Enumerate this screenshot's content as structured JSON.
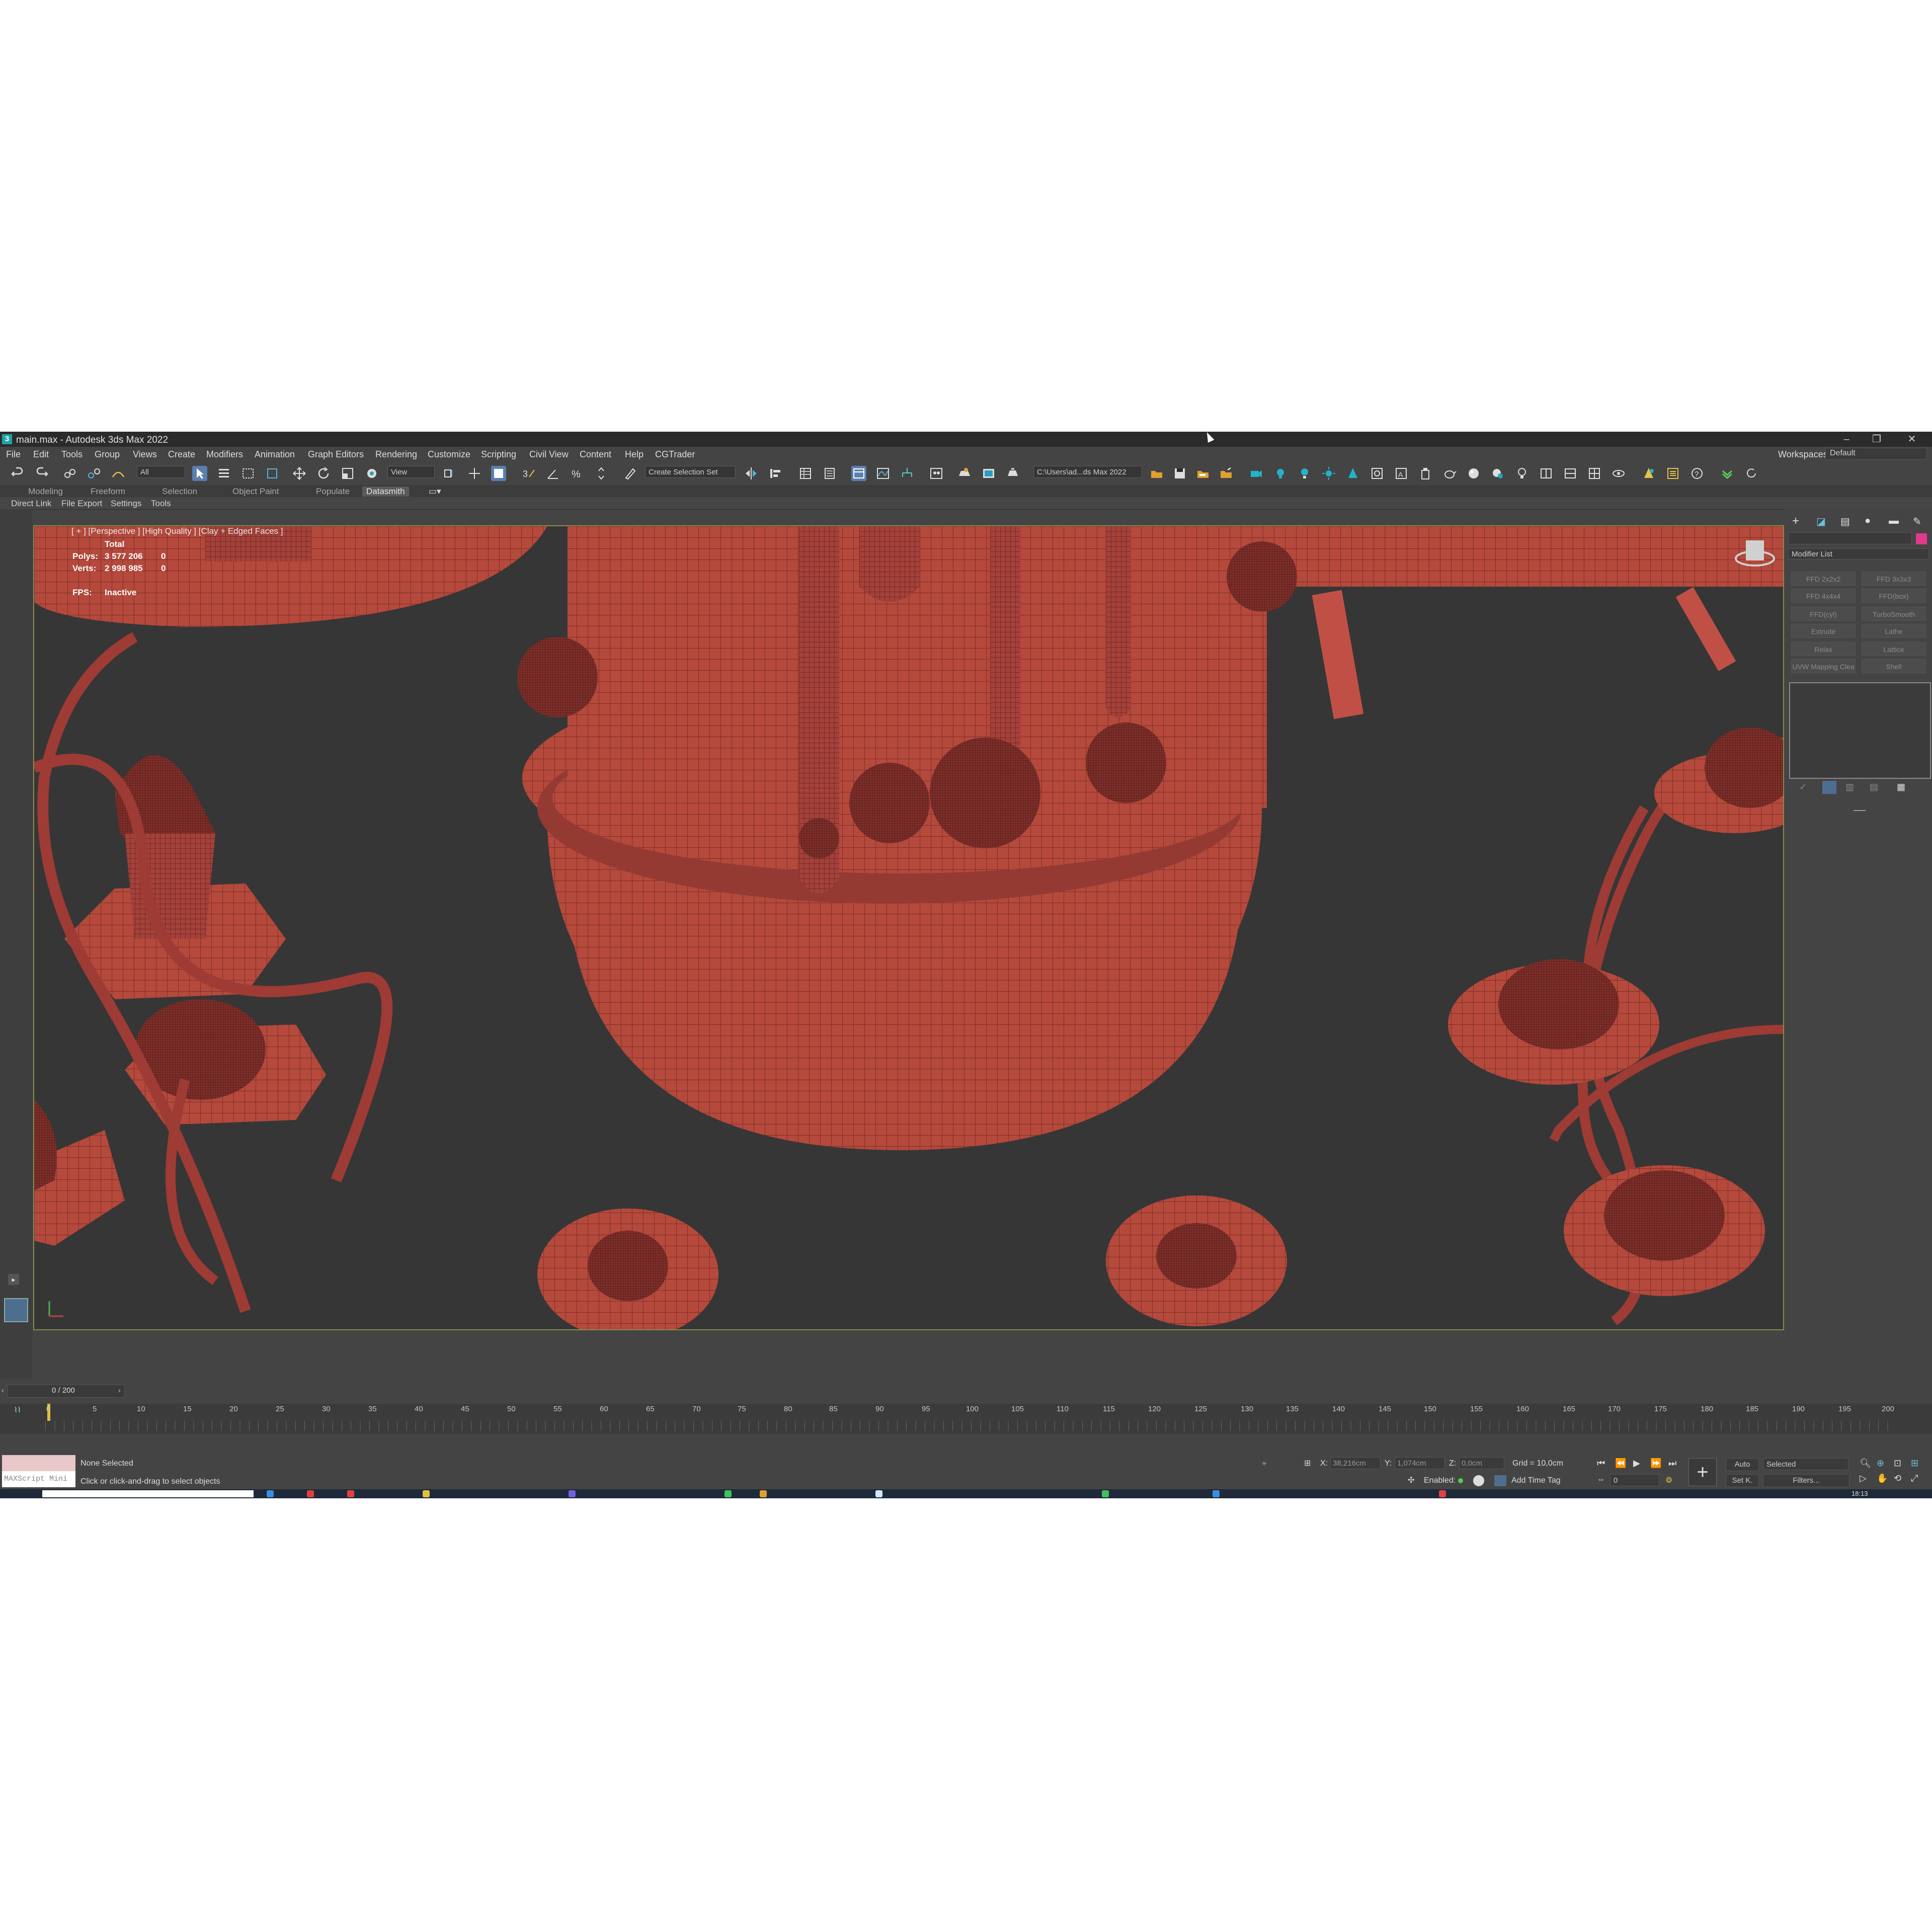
{
  "window": {
    "title": "main.max - Autodesk 3ds Max 2022",
    "app_icon": "3",
    "minimize": "–",
    "restore": "❐",
    "close": "✕"
  },
  "workspaces": {
    "label": "Workspaces:",
    "value": "Default"
  },
  "menu": [
    "File",
    "Edit",
    "Tools",
    "Group",
    "Views",
    "Create",
    "Modifiers",
    "Animation",
    "Graph Editors",
    "Rendering",
    "Customize",
    "Scripting",
    "Civil View",
    "Content",
    "Help",
    "CGTrader"
  ],
  "toolbar": {
    "selection_filter": "All",
    "ref_coord": "View",
    "selection_set": "Create Selection Set",
    "project_path": "C:\\Users\\ad...ds Max 2022"
  },
  "ribbon_tabs": [
    "Modeling",
    "Freeform",
    "Selection",
    "Object Paint",
    "Populate",
    "Datasmith"
  ],
  "ribbon_active": "Datasmith",
  "subribbon": [
    "Direct Link",
    "File Export",
    "Settings",
    "Tools"
  ],
  "viewport": {
    "label": "[ + ] [Perspective ] [High Quality ] [Clay + Edged Faces ]",
    "stats": {
      "total_label": "Total",
      "polys_label": "Polys:",
      "polys_value": "3 577 206",
      "polys_sel": "0",
      "verts_label": "Verts:",
      "verts_value": "2 998 985",
      "verts_sel": "0",
      "fps_label": "FPS:",
      "fps_value": "Inactive"
    }
  },
  "command_panel": {
    "modifier_list": "Modifier List",
    "buttons": [
      "FFD 2x2x2",
      "FFD 3x3x3",
      "FFD 4x4x4",
      "FFD(box)",
      "FFD(cyl)",
      "TurboSmooth",
      "Extrude",
      "Lathe",
      "Relax",
      "Lattice",
      "UVW Mapping Clea",
      "Shell"
    ]
  },
  "timeline": {
    "frame_counter": "0 / 200",
    "ticks": [
      "0",
      "5",
      "10",
      "15",
      "20",
      "25",
      "30",
      "35",
      "40",
      "45",
      "50",
      "55",
      "60",
      "65",
      "70",
      "75",
      "80",
      "85",
      "90",
      "95",
      "100",
      "105",
      "110",
      "115",
      "120",
      "125",
      "130",
      "135",
      "140",
      "145",
      "150",
      "155",
      "160",
      "165",
      "170",
      "175",
      "180",
      "185",
      "190",
      "195",
      "200"
    ]
  },
  "status": {
    "maxscript": "MAXScript Mini",
    "selection": "None Selected",
    "prompt": "Click or click-and-drag to select objects",
    "x_label": "X:",
    "x_value": "38,216cm",
    "y_label": "Y:",
    "y_value": "1,074cm",
    "z_label": "Z:",
    "z_value": "0,0cm",
    "grid": "Grid = 10,0cm",
    "enabled": "Enabled:",
    "add_time_tag": "Add Time Tag",
    "auto_key": "Auto",
    "set_key": "Set K.",
    "key_mode": "Selected",
    "filters": "Filters...",
    "frame_value": "0"
  },
  "taskbar": {
    "clock": "18:13"
  },
  "colors": {
    "model_red": "#b4493c",
    "viewport_bg": "#363636",
    "ui_bg": "#444444",
    "accent_teal": "#22b3c8"
  }
}
